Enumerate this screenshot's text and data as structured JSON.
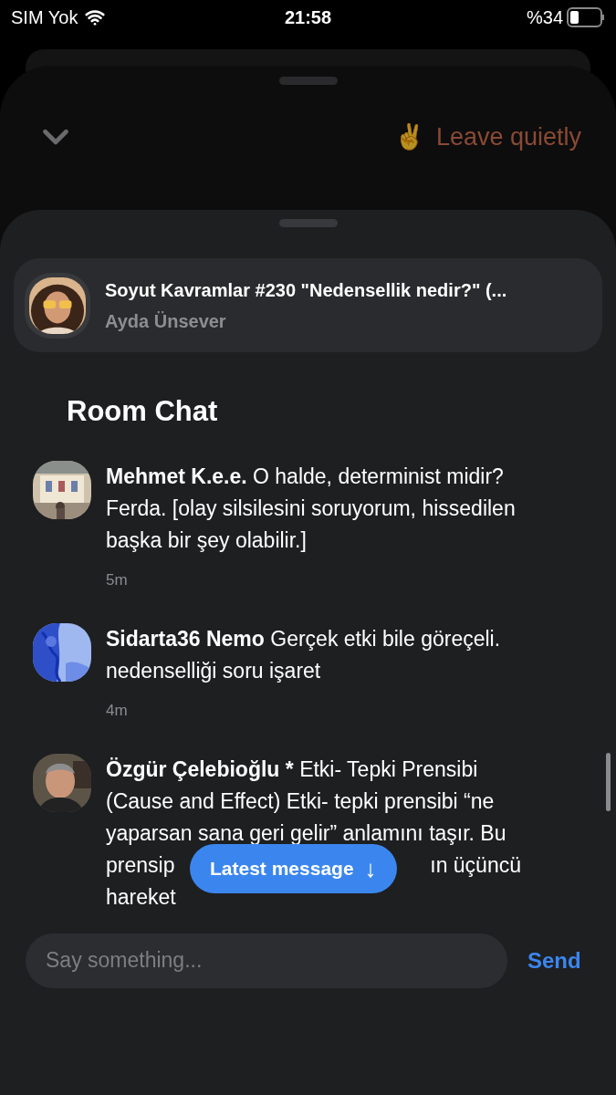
{
  "status_bar": {
    "carrier": "SIM Yok",
    "time": "21:58",
    "battery": "%34"
  },
  "back_sheet": {
    "leave_button": {
      "emoji": "✌️",
      "label": "Leave quietly"
    }
  },
  "room": {
    "title": "Soyut Kavramlar #230 \"Nedensellik nedir?\" (...",
    "host": "Ayda Ünsever"
  },
  "chat": {
    "title": "Room Chat",
    "messages": [
      {
        "author": "Mehmet K.e.e.",
        "text": "O halde, determinist midir? Ferda. [olay silsilesini soruyorum, hissedilen başka bir şey olabilir.]",
        "time": "5m"
      },
      {
        "author": "Sidarta36 Nemo",
        "text": "Gerçek etki bile göreçeli. nedenselliği soru işaret",
        "time": "4m"
      },
      {
        "author": "Özgür Çelebioğlu *",
        "text": "Etki- Tepki Prensibi (Cause and Effect) Etki- tepki prensibi “ne yaparsan sana geri gelir” anlamını taşır. Bu",
        "covered_line": [
          "prensip",
          "ın üçüncü"
        ],
        "tail": "hareket"
      }
    ]
  },
  "latest_button": {
    "label": "Latest message",
    "arrow": "↓"
  },
  "composer": {
    "placeholder": "Say something...",
    "send": "Send"
  }
}
